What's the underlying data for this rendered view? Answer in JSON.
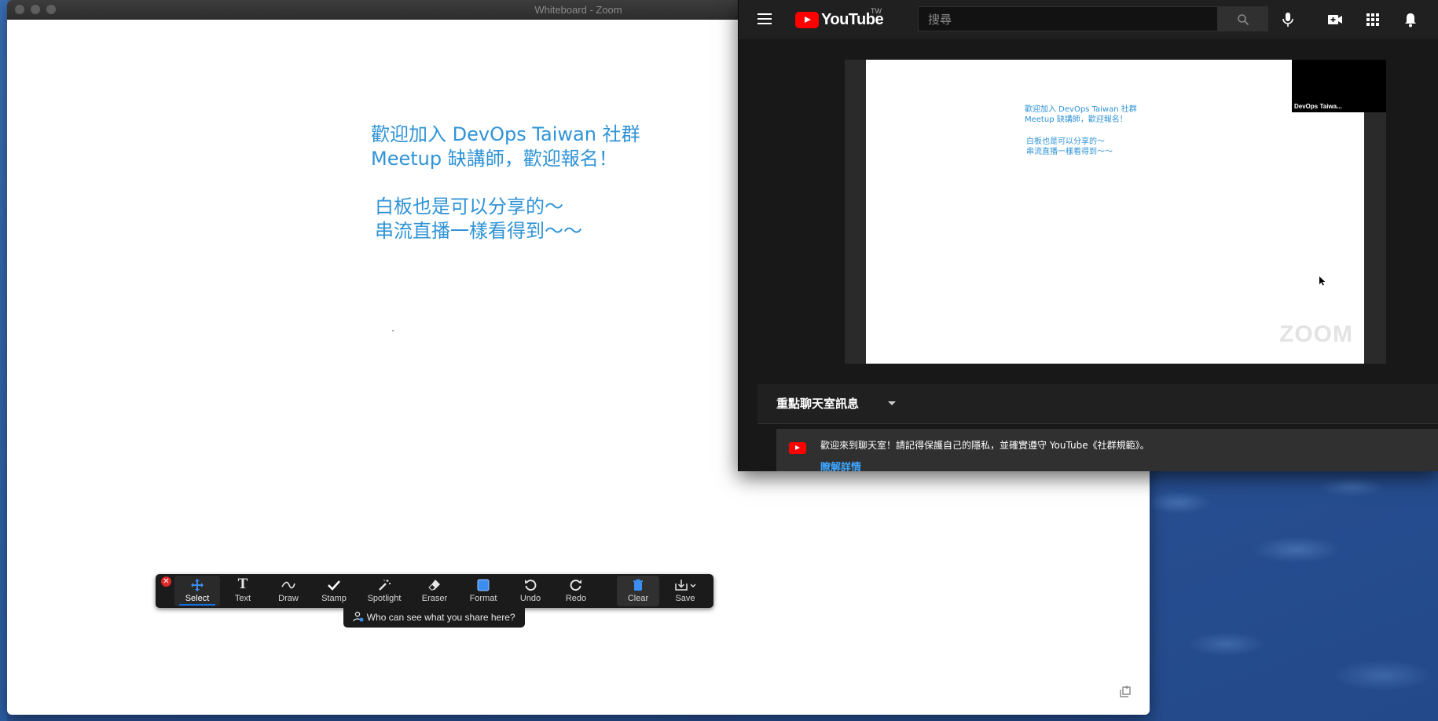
{
  "zoom": {
    "window_title": "Whiteboard - Zoom",
    "whiteboard_lines": [
      "歡迎加入 DevOps Taiwan 社群",
      "Meetup 缺講師，歡迎報名！",
      "白板也是可以分享的～",
      "串流直播一樣看得到～～"
    ],
    "toolbar": {
      "select": "Select",
      "text": "Text",
      "draw": "Draw",
      "stamp": "Stamp",
      "spotlight": "Spotlight",
      "eraser": "Eraser",
      "format": "Format",
      "undo": "Undo",
      "redo": "Redo",
      "clear": "Clear",
      "save": "Save",
      "accent_color": "#0e72ed"
    },
    "share_tooltip": "Who can see what you share here?"
  },
  "youtube": {
    "logo_text": "YouTube",
    "region": "TW",
    "search_placeholder": "搜尋",
    "player": {
      "screen_lines": [
        "歡迎加入 DevOps Taiwan 社群",
        "Meetup 缺講師，歡迎報名！",
        "白板也是可以分享的～",
        "串流直播一樣看得到～～"
      ],
      "participant_name": "DevOps Taiwa...",
      "watermark": "ZOOM"
    },
    "chat": {
      "header": "重點聊天室訊息",
      "welcome": "歡迎來到聊天室！請記得保護自己的隱私，並確實遵守 YouTube《社群規範》。",
      "learn_more": "瞭解詳情"
    },
    "brand_color": "#ff0000"
  }
}
